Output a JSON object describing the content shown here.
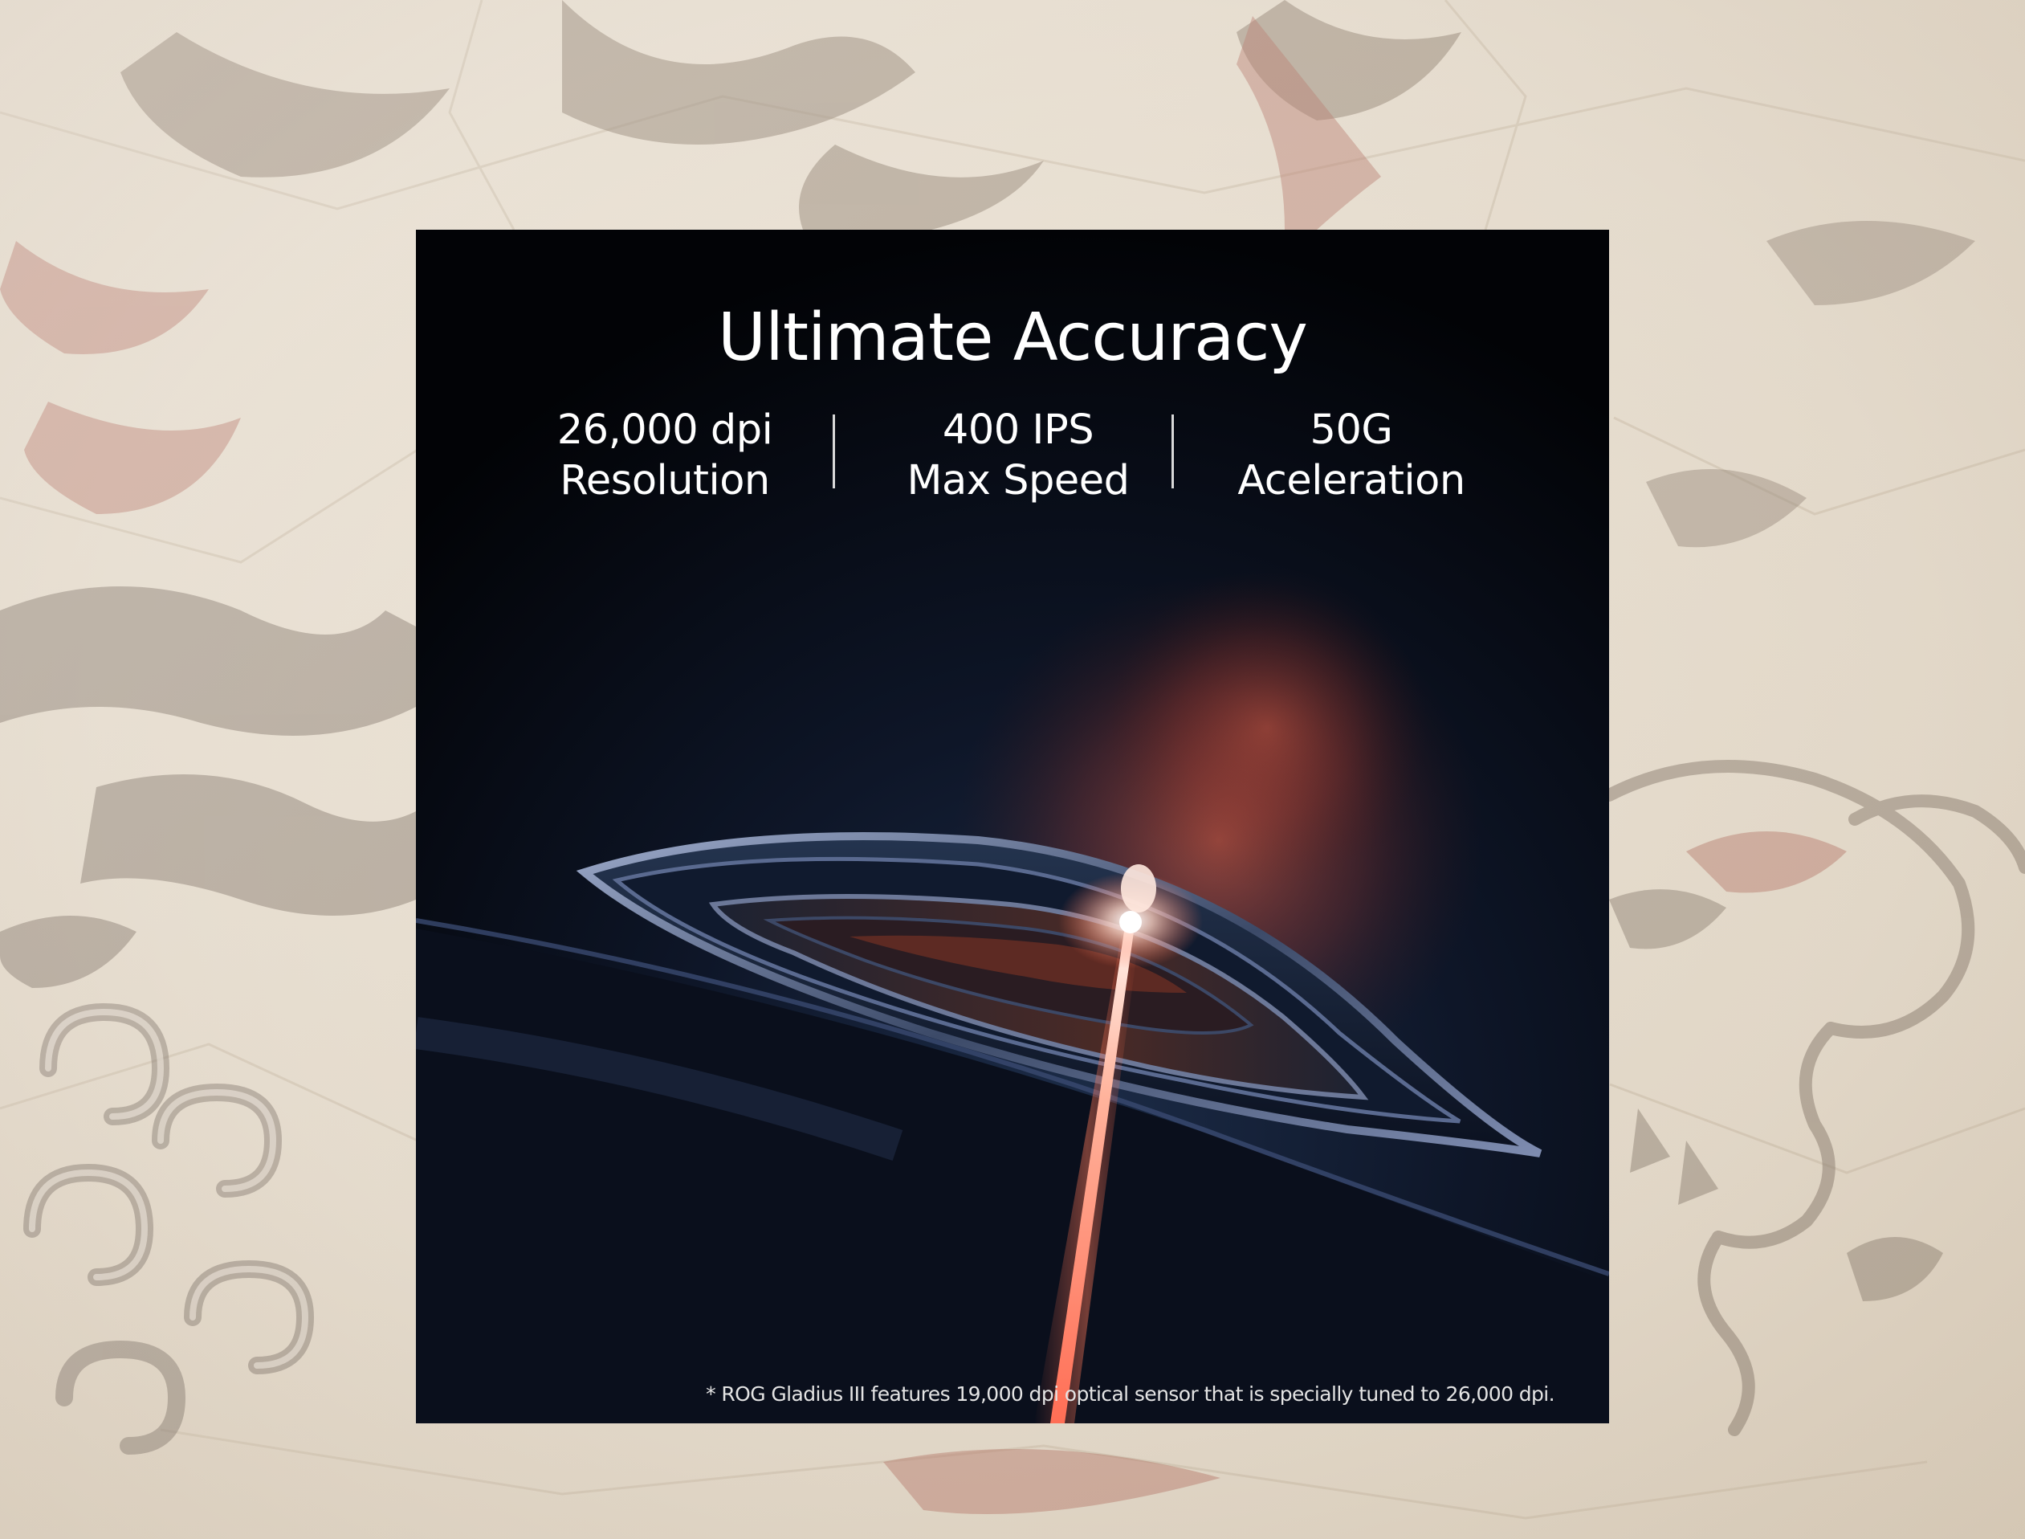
{
  "banner": {
    "title": "Ultimate Accuracy",
    "specs": [
      {
        "value": "26,000 dpi",
        "label": "Resolution"
      },
      {
        "value": "400 IPS",
        "label": "Max Speed"
      },
      {
        "value": "50G",
        "label": "Aceleration"
      }
    ],
    "footnote": "* ROG Gladius III features 19,000 dpi optical sensor that is specially tuned to 26,000 dpi."
  },
  "colors": {
    "background_parchment": "#e8ded0",
    "banner_background": "#05070c",
    "text": "#ffffff",
    "laser_accent": "#ff7a5a"
  },
  "icons": {
    "background": "dragon-artwork",
    "product": "mouse-optical-sensor"
  }
}
